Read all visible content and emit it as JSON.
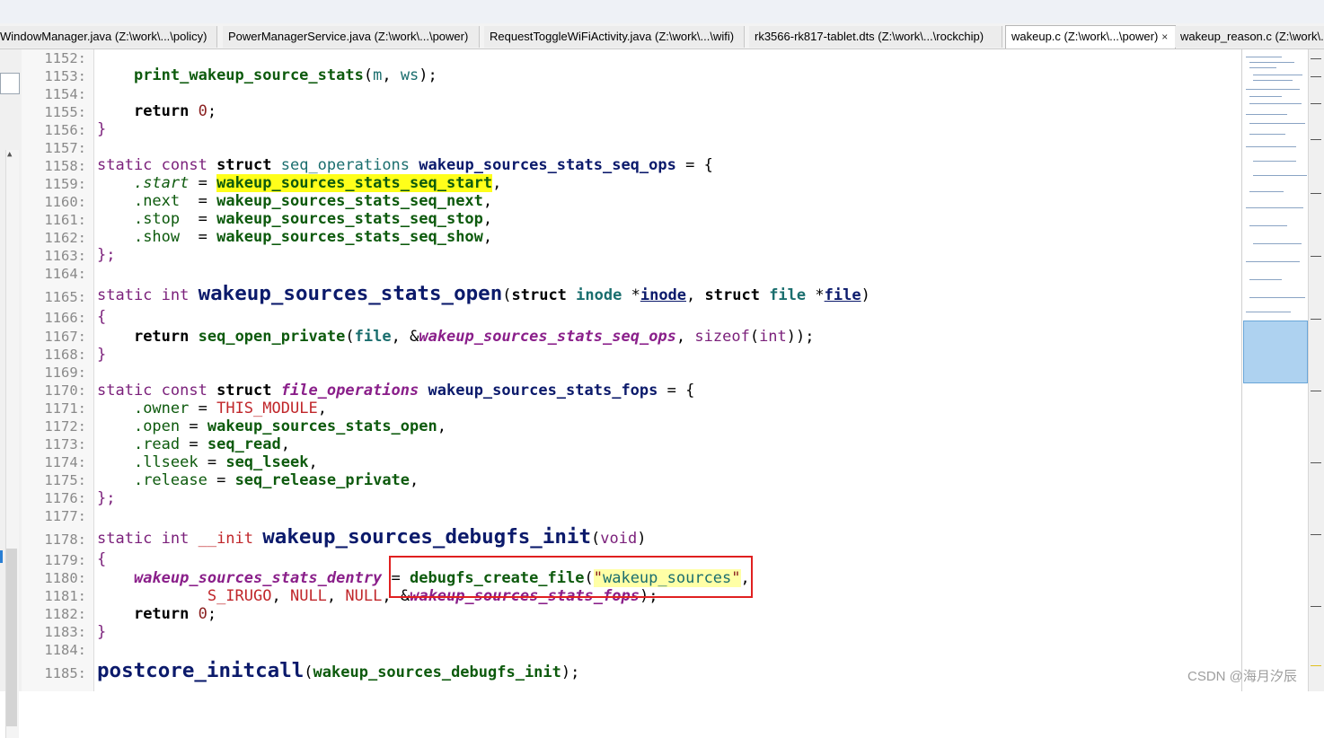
{
  "tabs": [
    {
      "label": "WindowManager.java (Z:\\work\\...\\policy)"
    },
    {
      "label": "PowerManagerService.java (Z:\\work\\...\\power)"
    },
    {
      "label": "RequestToggleWiFiActivity.java (Z:\\work\\...\\wifi)"
    },
    {
      "label": "rk3566-rk817-tablet.dts (Z:\\work\\...\\rockchip)"
    },
    {
      "label": "wakeup.c (Z:\\work\\...\\power)",
      "close": "×"
    },
    {
      "label": "wakeup_reason.c (Z:\\work\\...\\power)"
    }
  ],
  "line_numbers": [
    "1152:",
    "1153:",
    "1154:",
    "1155:",
    "1156:",
    "1157:",
    "1158:",
    "1159:",
    "1160:",
    "1161:",
    "1162:",
    "1163:",
    "1164:",
    "1165:",
    "1166:",
    "1167:",
    "1168:",
    "1169:",
    "1170:",
    "1171:",
    "1172:",
    "1173:",
    "1174:",
    "1175:",
    "1176:",
    "1177:",
    "1178:",
    "1179:",
    "1180:",
    "1181:",
    "1182:",
    "1183:",
    "1184:",
    "1185:"
  ],
  "code": {
    "print_call": "print_wakeup_source_stats",
    "print_args_open": "(",
    "m": "m",
    "comma_sp": ", ",
    "ws": "ws",
    "print_args_close": ");",
    "return_kw": "return",
    "zero": "0",
    "semi": ";",
    "brace_close": "}",
    "brace_open": "{",
    "brace_close_semi": "};",
    "static_const": "static const ",
    "struct_kw": "struct",
    "seq_operations": "seq_operations",
    "seq_ops_name": "wakeup_sources_stats_seq_ops",
    "eq_brace": " = {",
    "dot_start": ".start",
    "dot_next": ".next",
    "dot_stop": ".stop",
    "dot_show": ".show",
    "eq": " = ",
    "pad2_eq": "  = ",
    "pad1_eq": "  = ",
    "seq_start": "wakeup_sources_stats_seq_start",
    "seq_next": "wakeup_sources_stats_seq_next",
    "seq_stop": "wakeup_sources_stats_seq_stop",
    "seq_show": "wakeup_sources_stats_seq_show",
    "comma": ",",
    "static_int": "static int ",
    "open_fn": "wakeup_sources_stats_open",
    "paren_open": "(",
    "inode_type": "inode",
    "star": " *",
    "inode_var": "inode",
    "file_type": "file",
    "file_var": "file",
    "paren_close": ")",
    "seq_open_private": "seq_open_private",
    "file_arg": "file",
    "amp": "&",
    "seq_ops_ref": "wakeup_sources_stats_seq_ops",
    "sizeof": "sizeof",
    "int_kw": "int",
    "close_paren2": "));",
    "file_operations": "file_operations",
    "fops_name": "wakeup_sources_stats_fops",
    "dot_owner": ".owner",
    "this_module": "THIS_MODULE",
    "dot_open": ".open",
    "dot_read": ".read",
    "seq_read": "seq_read",
    "dot_llseek": ".llseek",
    "seq_lseek": "seq_lseek",
    "dot_release": ".release",
    "seq_release_private": "seq_release_private",
    "init_kw": "__init",
    "debugfs_init": "wakeup_sources_debugfs_init",
    "void_kw": "void",
    "dentry": "wakeup_sources_stats_dentry",
    "debugfs_create_file": "debugfs_create_file",
    "quote": "\"",
    "wakeup_sources_str": "wakeup_sources",
    "s_irugo": "S_IRUGO",
    "null": "NULL",
    "fops_ref": "wakeup_sources_stats_fops",
    "close_semi": ");",
    "postcore_initcall": "postcore_initcall",
    "initcall_arg": "wakeup_sources_debugfs_init"
  },
  "watermark": "CSDN @海月汐辰",
  "colors": {
    "highlight": "#ffff1a",
    "string_highlight": "#ffffa6",
    "callout_border": "#e02020",
    "minimap_view": "#aed2f0"
  }
}
